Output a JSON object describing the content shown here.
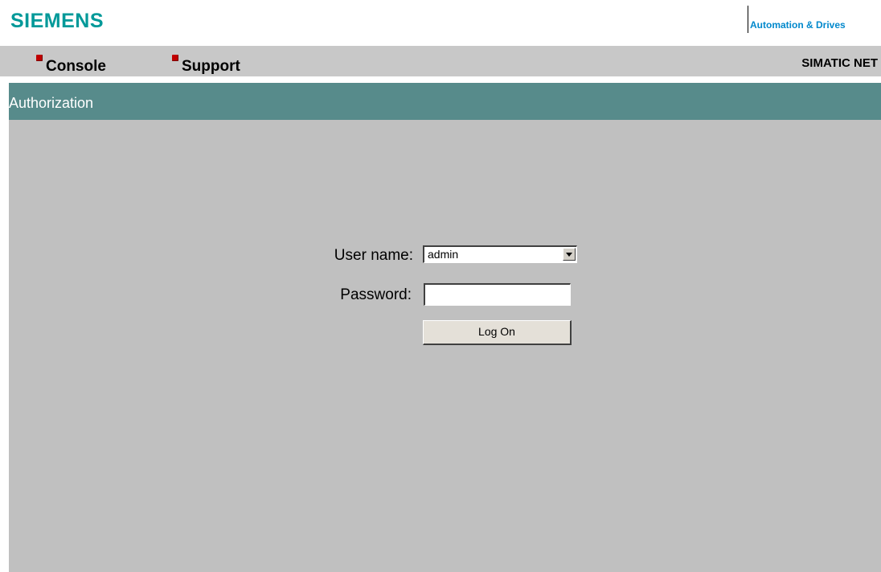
{
  "header": {
    "logo": "SIEMENS",
    "division": "Automation & Drives"
  },
  "nav": {
    "items": [
      {
        "label": "Console"
      },
      {
        "label": "Support"
      }
    ],
    "product": "SIMATIC NET"
  },
  "page": {
    "title": "Authorization"
  },
  "form": {
    "username_label": "User name:",
    "username_value": "admin",
    "password_label": "Password:",
    "password_value": "",
    "submit_label": "Log On"
  },
  "colors": {
    "brand": "#009999",
    "title_bar": "#578b8b",
    "nav_bg": "#c8c8c8",
    "content_bg": "#c0c0c0",
    "bullet": "#c00000",
    "division_text": "#0088cc"
  }
}
